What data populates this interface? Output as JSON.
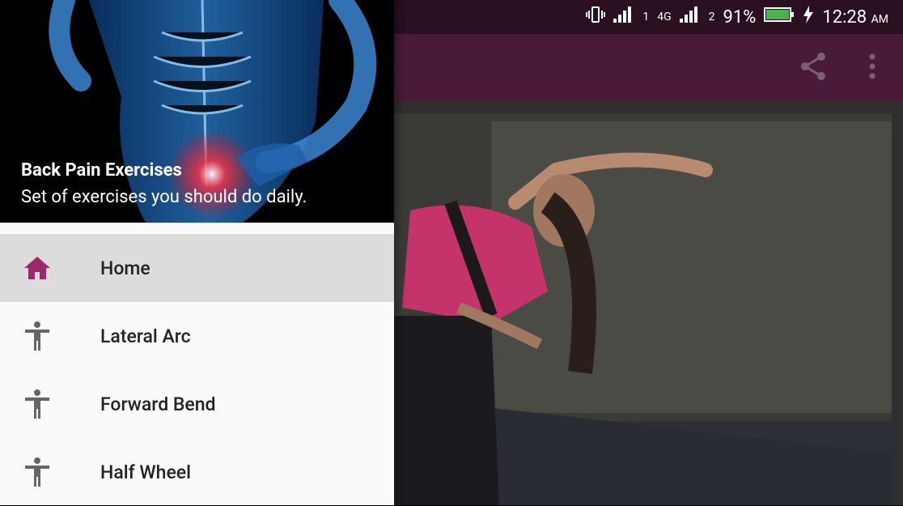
{
  "status_bar": {
    "network_label": "4G",
    "sim1": "1",
    "sim2": "2",
    "battery": "91%",
    "time": "12:28",
    "ampm": "AM"
  },
  "app_bar": {
    "share_icon": "share-icon",
    "more_icon": "more-vert-icon"
  },
  "drawer": {
    "title": "Back Pain Exercises",
    "subtitle": "Set of exercises you should do daily.",
    "items": [
      {
        "label": "Home",
        "icon": "home-icon",
        "active": true
      },
      {
        "label": "Lateral Arc",
        "icon": "person-icon",
        "active": false
      },
      {
        "label": "Forward Bend",
        "icon": "person-icon",
        "active": false
      },
      {
        "label": "Half Wheel",
        "icon": "person-icon",
        "active": false
      }
    ]
  },
  "colors": {
    "primary_dark": "#2a1020",
    "primary": "#4a1b38",
    "accent": "#9c2a6a",
    "drawer_bg": "#fafafa",
    "active_item_bg": "#dcdcdc"
  }
}
